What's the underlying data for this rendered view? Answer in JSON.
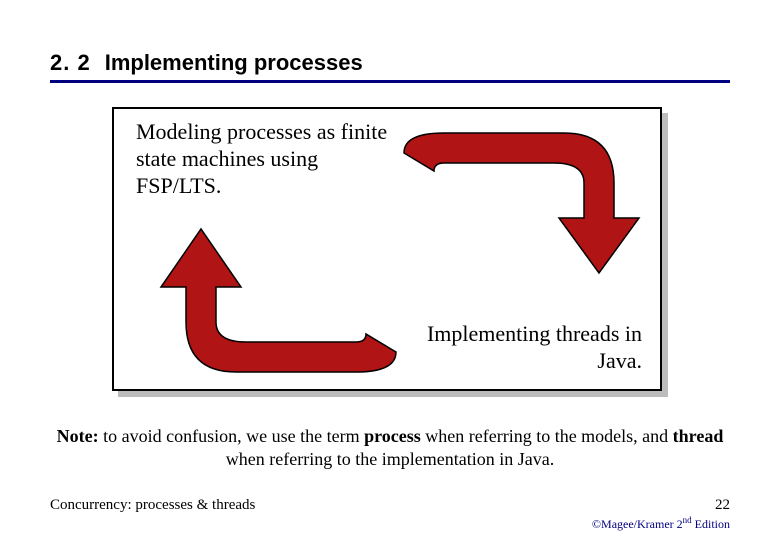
{
  "section": {
    "number": "2. 2",
    "title": "Implementing processes"
  },
  "box": {
    "top_text": "Modeling processes as finite state machines using FSP/LTS.",
    "bottom_text": "Implementing threads in Java."
  },
  "note": {
    "label": "Note:",
    "body_a": " to avoid confusion, we use the term ",
    "term1": "process",
    "body_b": " when referring to the models, and ",
    "term2": "thread",
    "body_c": " when referring to the implementation in Java."
  },
  "footer": {
    "left": "Concurrency: processes & threads",
    "page": "22",
    "copyright_pre": "©Magee/Kramer ",
    "copyright_ord": "2",
    "copyright_sup": "nd",
    "copyright_post": " Edition"
  },
  "colors": {
    "accent": "#000080",
    "arrow": "#b01414"
  }
}
